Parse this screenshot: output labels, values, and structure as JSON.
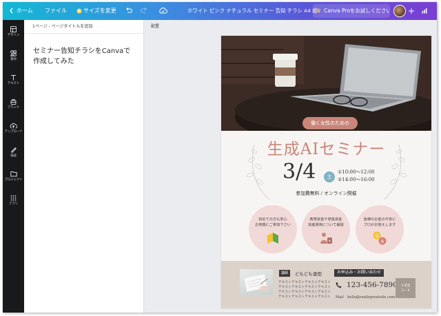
{
  "topbar": {
    "home": "ホーム",
    "file": "ファイル",
    "resize": "サイズを変更",
    "doc_title": "ホワイト ピンク ナチュラル セミナー 告知 チラシ A4 縦",
    "pro_button": "Canva Proをお試しください",
    "crown_icon": "crown-icon",
    "colors": {
      "gradient_start": "#13b8d4",
      "gradient_end": "#7a3fd3",
      "crown": "#ffd24a"
    }
  },
  "rail": [
    {
      "label": "デザイン",
      "icon": "design-icon"
    },
    {
      "label": "素材",
      "icon": "elements-icon"
    },
    {
      "label": "テキスト",
      "icon": "text-icon"
    },
    {
      "label": "ブランド",
      "icon": "brand-icon"
    },
    {
      "label": "アップロード",
      "icon": "upload-icon"
    },
    {
      "label": "描画",
      "icon": "draw-icon"
    },
    {
      "label": "プロジェクト",
      "icon": "projects-icon"
    },
    {
      "label": "アプリ",
      "icon": "apps-icon"
    }
  ],
  "notes_panel": {
    "header": "1ページ - ページタイトルを追加",
    "body": "セミナー告知チラシをCanvaで作成してみた"
  },
  "canvas": {
    "header": "配置"
  },
  "flyer": {
    "ribbon": "働く女性のための",
    "title": "生成AIセミナー",
    "date": "3/4",
    "day_of_week": "土",
    "time1": "①10:00〜12:00",
    "time2": "②14:00〜16:00",
    "fee": "参加費無料 / オンライン開催",
    "circles": [
      {
        "line1": "初めての方も安心",
        "line2": "お気軽にご参加下さい",
        "icon": "beginner-mark-icon"
      },
      {
        "line1": "教育資金や老後資金",
        "line2": "資産運用について解説",
        "icon": "money-bag-icon"
      },
      {
        "line1": "皆様のお金の不安に",
        "line2": "プロがお答えします",
        "icon": "qa-icon"
      }
    ],
    "footer": {
      "lecturer_tag": "講師",
      "lecturer_name": "どもども遠田",
      "text_lines": [
        "テキストテキストテキストテキスト",
        "テキストテキストテキストテキスト",
        "テキストテキストテキストテキスト",
        "テキストテキストテキストテキスト"
      ],
      "apply_tag": "お申込み・お問い合わせ",
      "phone": "123-456-7890",
      "mail_label": "Mail",
      "mail": "hello@reallygreatsite.com",
      "qr_line1": "２次元",
      "qr_line2": "コード"
    },
    "colors": {
      "accent": "#c98579",
      "circle": "#f1d9d7",
      "footer": "#dcd2ca",
      "day_badge": "#7fb3c4"
    }
  }
}
